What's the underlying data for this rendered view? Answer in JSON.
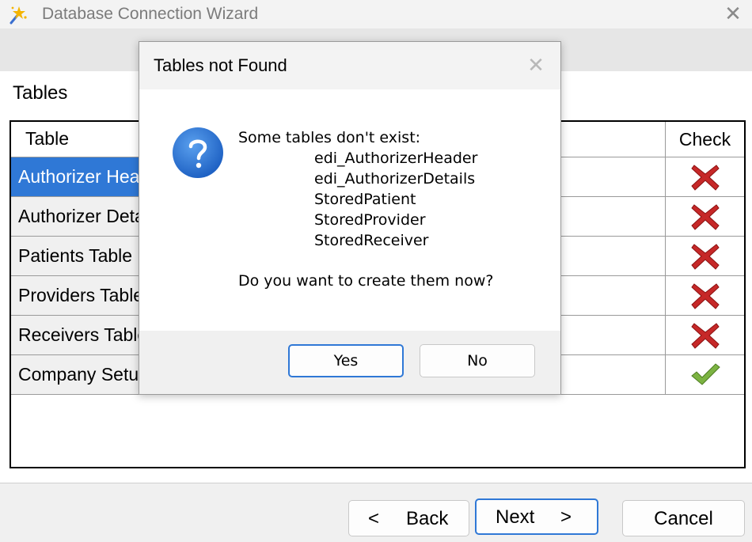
{
  "window": {
    "title": "Database Connection Wizard",
    "close_glyph": "✕"
  },
  "section": {
    "title": "Tables"
  },
  "grid": {
    "columns": [
      "Table",
      "Check"
    ],
    "rows": [
      {
        "name": "Authorizer Header",
        "status": "missing",
        "selected": true
      },
      {
        "name": "Authorizer Details",
        "status": "missing",
        "selected": false
      },
      {
        "name": "Patients Table",
        "status": "missing",
        "selected": false
      },
      {
        "name": "Providers Table",
        "status": "missing",
        "selected": false
      },
      {
        "name": "Receivers Table",
        "status": "missing",
        "selected": false
      },
      {
        "name": "Company Setup",
        "status": "ok",
        "selected": false
      }
    ]
  },
  "buttons": {
    "back": "Back",
    "back_glyph": "<",
    "next": "Next",
    "next_glyph": ">",
    "cancel": "Cancel"
  },
  "dialog": {
    "title": "Tables not Found",
    "close_glyph": "✕",
    "message": "Some tables don't exist:",
    "tables": [
      "edi_AuthorizerHeader",
      "edi_AuthorizerDetails",
      "StoredPatient",
      "StoredProvider",
      "StoredReceiver"
    ],
    "question": "Do you want to create them now?",
    "yes": "Yes",
    "no": "No"
  },
  "colors": {
    "selection": "#2f78d6",
    "error_x": "#c62828",
    "ok_check": "#7cb342",
    "question_icon": "#2f78d6"
  },
  "icons": {
    "app": "wizard-wand-icon",
    "dialog": "question-icon",
    "missing": "red-x-icon",
    "ok": "green-check-icon"
  }
}
